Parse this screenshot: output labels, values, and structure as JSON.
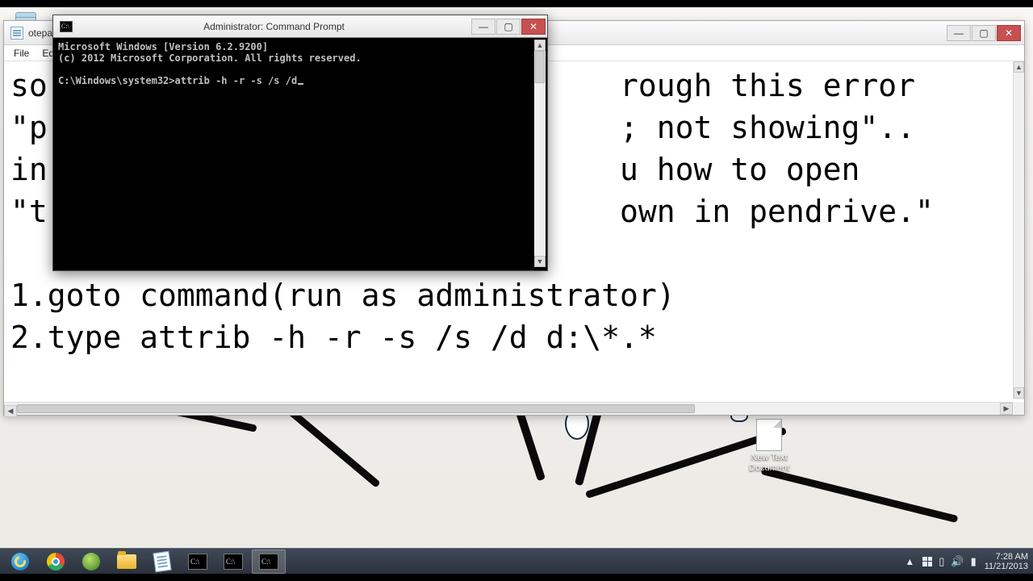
{
  "notepad": {
    "title": "otepad",
    "menu": {
      "file": "File",
      "edit": "Edit"
    },
    "lines": [
      "so                               rough this error",
      "\"p                               ; not showing\"..",
      "in                               u how to open",
      "\"t                               own in pendrive.\"",
      "",
      "1.goto command(run as administrator)",
      "2.type attrib -h -r -s /s /d d:\\*.*"
    ]
  },
  "cmd": {
    "title": "Administrator: Command Prompt",
    "lines": [
      "Microsoft Windows [Version 6.2.9200]",
      "(c) 2012 Microsoft Corporation. All rights reserved.",
      "",
      "C:\\Windows\\system32>attrib -h -r -s /s /d"
    ]
  },
  "desktop": {
    "file_label": "New Text Document"
  },
  "taskbar": {
    "time": "7:28 AM",
    "date": "11/21/2013"
  }
}
